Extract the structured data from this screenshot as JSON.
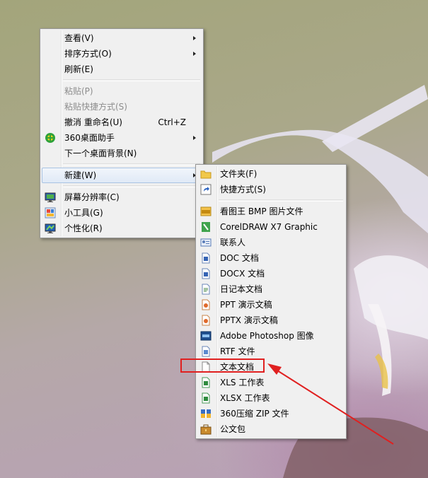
{
  "desktop_menu": {
    "items": [
      {
        "label": "查看(V)",
        "submenu": true
      },
      {
        "label": "排序方式(O)",
        "submenu": true
      },
      {
        "label": "刷新(E)"
      },
      {
        "label": "粘贴(P)",
        "disabled": true
      },
      {
        "label": "粘贴快捷方式(S)",
        "disabled": true
      },
      {
        "label": "撤消 重命名(U)",
        "shortcut": "Ctrl+Z"
      },
      {
        "label": "360桌面助手",
        "submenu": true,
        "icon": "360-icon"
      },
      {
        "label": "下一个桌面背景(N)"
      },
      {
        "label": "新建(W)",
        "submenu": true,
        "highlighted": true
      },
      {
        "label": "屏幕分辨率(C)",
        "icon": "display-icon"
      },
      {
        "label": "小工具(G)",
        "icon": "gadgets-icon"
      },
      {
        "label": "个性化(R)",
        "icon": "personalize-icon"
      }
    ]
  },
  "new_submenu": {
    "items": [
      {
        "label": "文件夹(F)",
        "icon": "folder-icon"
      },
      {
        "label": "快捷方式(S)",
        "icon": "shortcut-icon"
      },
      {
        "label": "看图王 BMP 图片文件",
        "icon": "bmp-icon"
      },
      {
        "label": "CorelDRAW X7 Graphic",
        "icon": "coreldraw-icon"
      },
      {
        "label": "联系人",
        "icon": "contact-icon"
      },
      {
        "label": "DOC 文档",
        "icon": "doc-icon"
      },
      {
        "label": "DOCX 文档",
        "icon": "docx-icon"
      },
      {
        "label": "日记本文档",
        "icon": "journal-icon"
      },
      {
        "label": "PPT 演示文稿",
        "icon": "ppt-icon"
      },
      {
        "label": "PPTX 演示文稿",
        "icon": "pptx-icon"
      },
      {
        "label": "Adobe Photoshop 图像",
        "icon": "psd-icon"
      },
      {
        "label": "RTF 文件",
        "icon": "rtf-icon"
      },
      {
        "label": "文本文档",
        "icon": "text-document-icon",
        "annotated": true
      },
      {
        "label": "XLS 工作表",
        "icon": "xls-icon"
      },
      {
        "label": "XLSX 工作表",
        "icon": "xlsx-icon"
      },
      {
        "label": "360压缩 ZIP 文件",
        "icon": "zip-icon"
      },
      {
        "label": "公文包",
        "icon": "briefcase-icon"
      }
    ]
  },
  "colors": {
    "annotation": "#e02020",
    "menu_bg": "#f0f0f0"
  }
}
